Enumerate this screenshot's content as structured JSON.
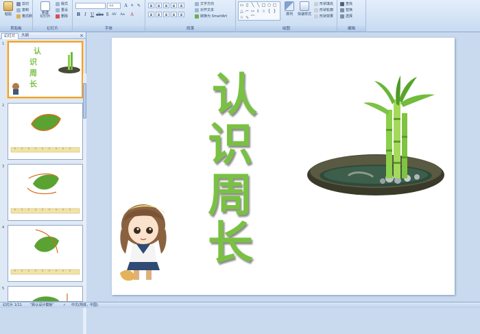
{
  "ribbon": {
    "clipboard": {
      "label": "剪贴板",
      "paste": "粘贴",
      "cut": "剪切",
      "copy": "复制",
      "format_painter": "格式刷"
    },
    "slides": {
      "label": "幻灯片",
      "new_slide": "新建\n幻灯片",
      "layout": "版式",
      "reset": "重设",
      "delete": "删除"
    },
    "font": {
      "label": "字体",
      "font_name": "",
      "font_size": "44"
    },
    "paragraph": {
      "label": "段落",
      "text_direction": "文字方向",
      "align_text": "对齐文本",
      "smartart": "转换为 SmartArt"
    },
    "drawing": {
      "label": "绘图",
      "arrange": "排列",
      "quick_styles": "快速样式",
      "shape_fill": "形状填充",
      "shape_outline": "形状轮廓",
      "shape_effects": "形状效果"
    },
    "editing": {
      "label": "编辑",
      "find": "查找",
      "replace": "替换",
      "select": "选择"
    }
  },
  "left_pane": {
    "tab_slides": "幻灯片",
    "tab_outline": "大纲",
    "close": "×",
    "thumbnails": [
      {
        "num": "1"
      },
      {
        "num": "2"
      },
      {
        "num": "3"
      },
      {
        "num": "4"
      },
      {
        "num": "5"
      }
    ]
  },
  "slide": {
    "title_chars": [
      "认",
      "识",
      "周",
      "长"
    ]
  },
  "status": {
    "slide_counter": "幻灯片 1/11",
    "theme": "\"默认设计模板\"",
    "language": "中文(简体，中国)"
  },
  "colors": {
    "title_green": "#7ac143",
    "leaf_green": "#5aa332",
    "selection_orange": "#f0a030"
  }
}
